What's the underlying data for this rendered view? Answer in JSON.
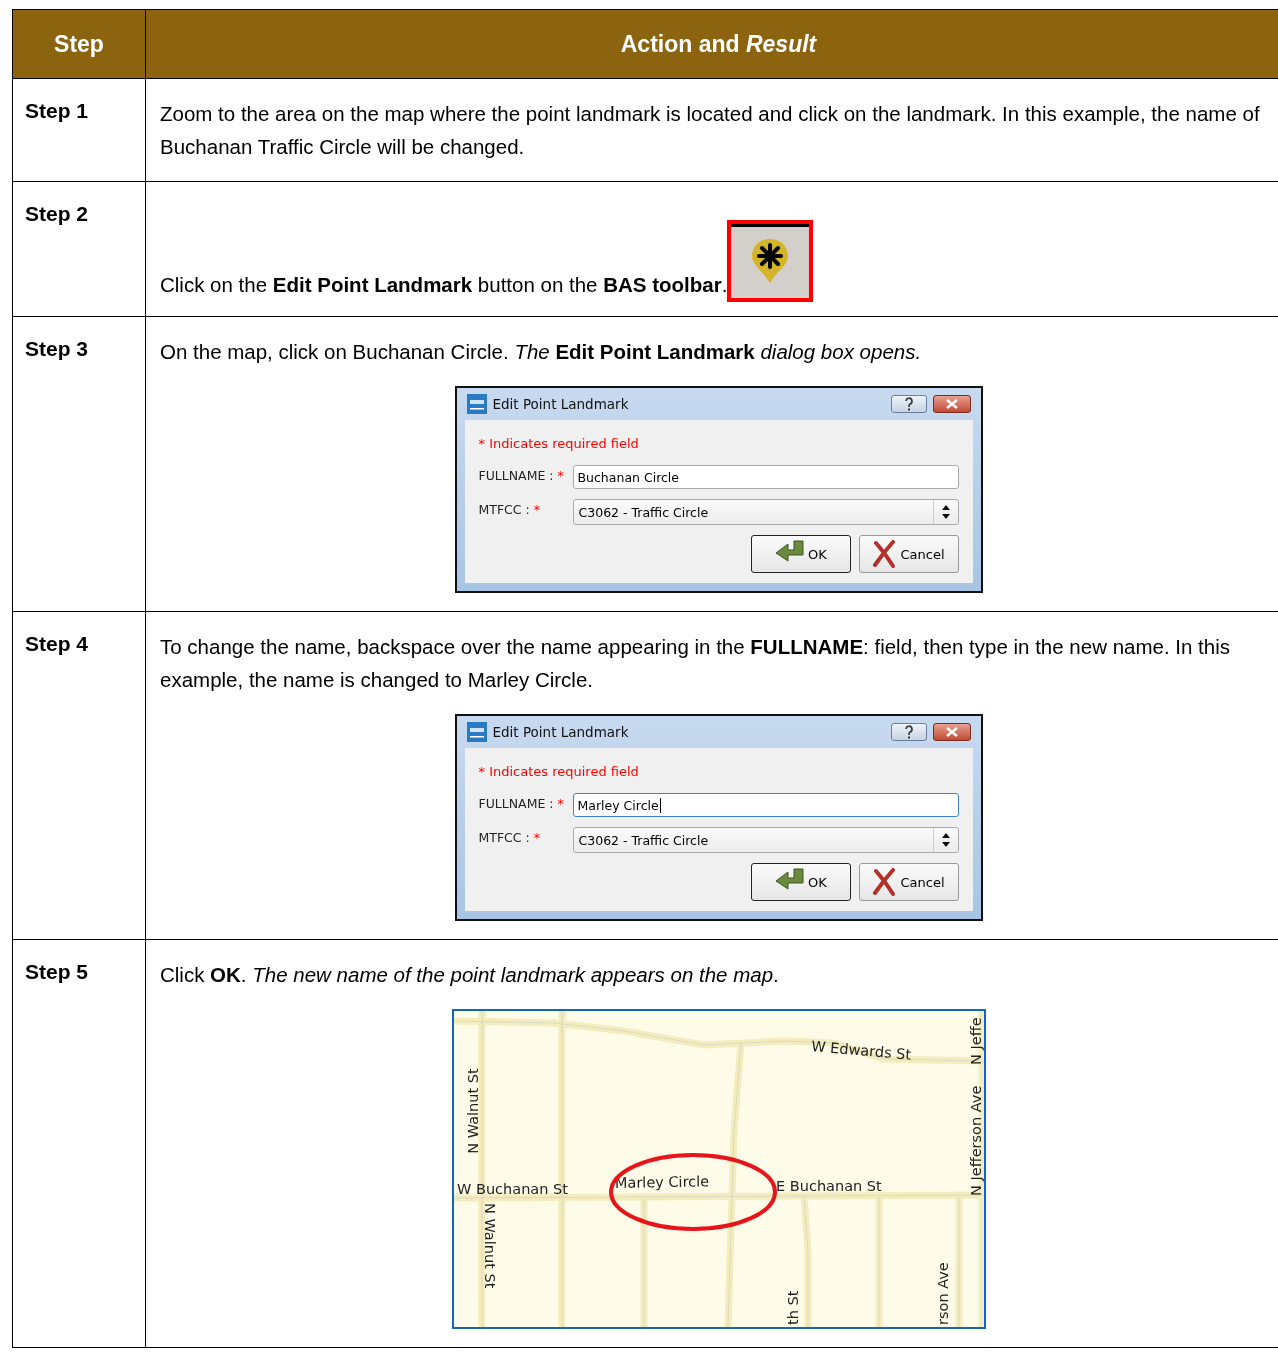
{
  "table": {
    "columns": [
      "Step",
      "Action and *Result*"
    ],
    "rows": [
      {
        "step": "Step 1",
        "content": [
          {
            "kind": "text",
            "text": "Zoom to the area on the map where the point landmark is located and click on the landmark. In this example, the name of Buchanan Traffic Circle will be changed."
          }
        ]
      },
      {
        "step": "Step 2",
        "content": [
          {
            "kind": "text_button",
            "text": "Click on the **Edit Point Landmark** button on the **BAS toolbar**."
          }
        ]
      },
      {
        "step": "Step 3",
        "content": [
          {
            "kind": "text",
            "text": "On the map, click on Buchanan Circle. *The* **Edit Point Landmark** *dialog box opens.*"
          },
          {
            "kind": "dialog",
            "title": "Edit Point Landmark",
            "note": "* Indicates required field",
            "fields": [
              {
                "kind": "text",
                "label": "FULLNAME :",
                "mark": "*",
                "value": "Buchanan Circle",
                "focused": false
              },
              {
                "kind": "select",
                "label": "MTFCC :",
                "mark": "*",
                "value": "C3062 - Traffic Circle"
              }
            ],
            "buttons": [
              {
                "kind": "ok",
                "label": "OK"
              },
              {
                "kind": "cancel",
                "label": "Cancel"
              }
            ]
          }
        ]
      },
      {
        "step": "Step 4",
        "content": [
          {
            "kind": "text",
            "text": "To change the name, backspace over the name appearing in the **FULLNAME**: field, then type in the new name. In this example, the name is changed to Marley Circle."
          },
          {
            "kind": "dialog",
            "title": "Edit Point Landmark",
            "note": "* Indicates required field",
            "fields": [
              {
                "kind": "text",
                "label": "FULLNAME :",
                "mark": "*",
                "value": "Marley Circle",
                "focused": true
              },
              {
                "kind": "select",
                "label": "MTFCC :",
                "mark": "*",
                "value": "C3062 - Traffic Circle"
              }
            ],
            "buttons": [
              {
                "kind": "ok",
                "label": "OK"
              },
              {
                "kind": "cancel",
                "label": "Cancel"
              }
            ]
          }
        ]
      },
      {
        "step": "Step 5",
        "content": [
          {
            "kind": "text",
            "text": "Click **OK**. *The new name of the point landmark appears on the map*."
          },
          {
            "kind": "map",
            "labels": [
              {
                "text": "W Edwards St",
                "circled": false
              },
              {
                "text": "N Walnut St",
                "circled": false
              },
              {
                "text": "W Buchanan St",
                "circled": false
              },
              {
                "text": "Marley Circle",
                "circled": true
              },
              {
                "text": "E Buchanan St",
                "circled": false
              },
              {
                "text": "N Jefferson Ave",
                "circled": false
              },
              {
                "text": "N Jeffe",
                "circled": false
              },
              {
                "text": "N Walnut St",
                "circled": false
              },
              {
                "text": "th St",
                "circled": false
              },
              {
                "text": "rson Ave",
                "circled": false
              }
            ]
          }
        ]
      }
    ]
  }
}
